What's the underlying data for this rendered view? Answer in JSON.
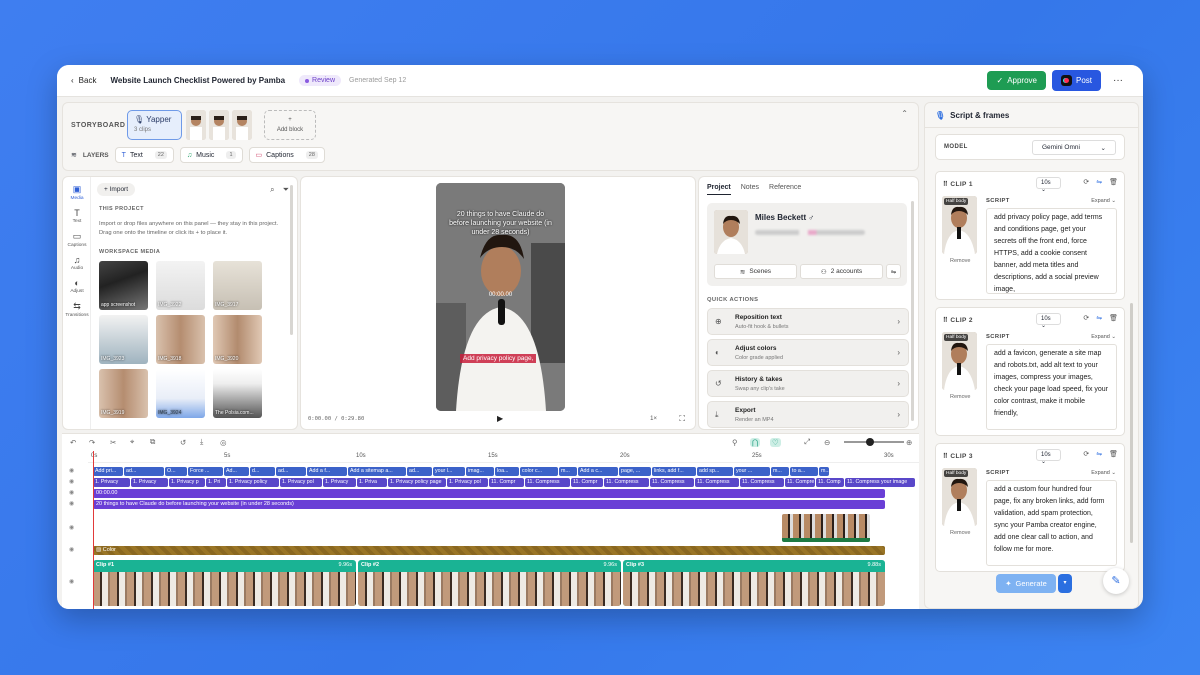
{
  "header": {
    "back": "Back",
    "title": "Website Launch Checklist Powered by Pamba",
    "status": "Review",
    "generated": "Generated Sep 12",
    "approve": "Approve",
    "post": "Post",
    "more": "···"
  },
  "storyboard": {
    "label": "STORYBOARD",
    "block_name": "Yapper",
    "block_sub": "3 clips",
    "add_block": "Add block"
  },
  "layers": {
    "label": "LAYERS",
    "items": [
      {
        "name": "Text",
        "count": "22"
      },
      {
        "name": "Music",
        "count": "1"
      },
      {
        "name": "Captions",
        "count": "28"
      }
    ]
  },
  "rail": [
    "Media",
    "Text",
    "Captions",
    "Audio",
    "Adjust",
    "Transitions"
  ],
  "media": {
    "import": "Import",
    "this_project": "THIS PROJECT",
    "desc": "Import or drop files anywhere on this panel — they stay in this project. Drag one onto the timeline or click its + to place it.",
    "workspace": "WORKSPACE MEDIA",
    "items": [
      "app screenshot",
      "IMG_3922",
      "IMG_3917",
      "IMG_3923",
      "IMG_3918",
      "IMG_3920",
      "IMG_3919",
      "IMG_3924",
      "The Polsia.com..."
    ]
  },
  "preview": {
    "overlay": "20 things to have Claude do before launching your website (in under 28 seconds)",
    "clock": "00:00.00",
    "subtitle": "Add privacy policy page,",
    "time": "0:00.00 / 0:29.80",
    "speed": "1×"
  },
  "project": {
    "tabs": [
      "Project",
      "Notes",
      "Reference"
    ],
    "name": "Miles Beckett ♂",
    "scenes": "Scenes",
    "accounts": "2 accounts",
    "quick_actions": "QUICK ACTIONS",
    "actions": [
      {
        "t": "Reposition text",
        "d": "Auto-fit hook & bullets"
      },
      {
        "t": "Adjust colors",
        "d": "Color grade applied"
      },
      {
        "t": "History & takes",
        "d": "Swap any clip's take"
      },
      {
        "t": "Export",
        "d": "Render an MP4"
      }
    ]
  },
  "ruler": [
    "0s",
    "5s",
    "10s",
    "15s",
    "20s",
    "25s",
    "30s"
  ],
  "timeline": {
    "row1": [
      "Add pri...",
      "ad...",
      "O...",
      "Force ...",
      "Ad...",
      "d...",
      "ad...",
      "Add a f...",
      "Add a sitemap a...",
      "ad...",
      "your l...",
      "imag...",
      "loa...",
      "color c...",
      "m...",
      "Add a c...",
      "page, ...",
      "links, add f...",
      "add sp...",
      "your ...",
      "m...",
      "to a...",
      "m..."
    ],
    "row2": [
      "1. Privacy",
      "1. Privacy",
      "1. Privacy p",
      "1. Pri",
      "1. Privacy policy",
      "1. Privacy pol",
      "1. Privacy",
      "1. Priva",
      "1. Privacy policy page",
      "1. Privacy pol",
      "11. Compr",
      "11. Compress",
      "11. Compr",
      "11. Compress",
      "11. Compress",
      "11. Compress",
      "11. Compress",
      "11. Compre",
      "11. Comp",
      "11. Compress your image"
    ],
    "timecode": "00:00.00",
    "title_bar": "20 things to have Claude do before launching your website (in under 28 seconds)",
    "color": "Color",
    "clips": [
      {
        "name": "Clip #1",
        "dur": "9.96s"
      },
      {
        "name": "Clip #2",
        "dur": "9.96s"
      },
      {
        "name": "Clip #3",
        "dur": "9.88s"
      }
    ]
  },
  "script": {
    "title": "Script & frames",
    "model_label": "MODEL",
    "model": "Gemini Omni",
    "script_label": "SCRIPT",
    "expand": "Expand",
    "half_body": "Half body",
    "remove": "Remove",
    "generate": "Generate",
    "clips": [
      {
        "title": "CLIP 1",
        "dur": "10s",
        "text": "add privacy policy page, add terms and conditions page, get your secrets off the front end, force HTTPS, add a cookie consent banner, add meta titles and descriptions, add a social preview image,"
      },
      {
        "title": "CLIP 2",
        "dur": "10s",
        "text": "add a favicon, generate a site map and robots.txt, add alt text to your images, compress your images, check your page load speed, fix your color contrast, make it mobile friendly,"
      },
      {
        "title": "CLIP 3",
        "dur": "10s",
        "text": "add a custom four hundred four page, fix any broken links, add form validation, add spam protection, sync your Pamba creator engine, add one clear call to action, and follow me for more."
      }
    ]
  }
}
